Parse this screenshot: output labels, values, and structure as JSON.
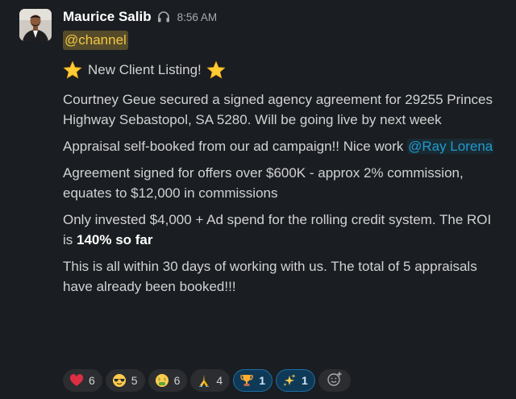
{
  "message": {
    "author": "Maurice Salib",
    "author_icon": "headphones-icon",
    "timestamp": "8:56 AM",
    "channel_mention": "@channel",
    "title": "New Client Listing!",
    "title_emoji": "star-icon",
    "paragraphs": {
      "p1": "Courtney Geue secured a signed agency agreement for 29255 Princes Highway Sebastopol, SA 5280. Will be going live by next week",
      "p2_before": "Appraisal self-booked from our ad campaign!! Nice work ",
      "p2_mention": "@Ray Lorena",
      "p3": "Agreement signed for offers over $600K - approx 2% commission, equates to $12,000 in commissions",
      "p4_before": "Only invested $4,000 + Ad spend for the rolling credit system. The ROI is ",
      "p4_bold": "140% so far",
      "p5": "This is all within 30 days of working with us. The total of 5 appraisals have already been booked!!!"
    }
  },
  "reactions": [
    {
      "emoji": "heart-icon",
      "count": "6",
      "active": false
    },
    {
      "emoji": "sunglasses-face-icon",
      "count": "5",
      "active": false
    },
    {
      "emoji": "money-mouth-face-icon",
      "count": "6",
      "active": false
    },
    {
      "emoji": "folded-hands-icon",
      "count": "4",
      "active": false
    },
    {
      "emoji": "trophy-icon",
      "count": "1",
      "active": true
    },
    {
      "emoji": "sparkles-icon",
      "count": "1",
      "active": true
    }
  ],
  "add_reaction_icon": "add-reaction-icon",
  "colors": {
    "background": "#1a1d21",
    "text": "#d1d2d3",
    "author": "#ffffff",
    "mention_link": "#1d9bd1",
    "channel_mention": "#f2c744",
    "active_reaction_bg": "#0f3a57",
    "active_reaction_border": "#1d6fa5"
  }
}
